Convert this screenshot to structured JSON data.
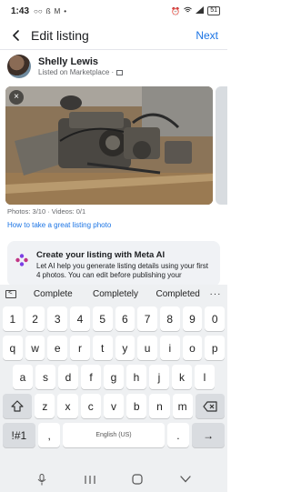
{
  "status_bar": {
    "time": "1:43",
    "left_icons": [
      "voicemail-icon",
      "bluetooth-icon",
      "gmail-icon",
      "dot-icon"
    ],
    "right_icons": [
      "alarm-icon",
      "wifi-icon",
      "signal-icon",
      "battery-icon"
    ],
    "battery_text": "51"
  },
  "header": {
    "title": "Edit listing",
    "next_label": "Next"
  },
  "profile": {
    "name": "Shelly Lewis",
    "subtitle": "Listed on Marketplace ·"
  },
  "photos": {
    "count_text": "Photos: 3/10 · Videos: 0/1",
    "remove_label": "×",
    "tip_link": "How to take a great listing photo"
  },
  "ai_card": {
    "title": "Create your listing with Meta AI",
    "body": "Let AI help you generate listing details using your first 4 photos. You can edit before publishing your"
  },
  "suggestions": [
    "Complete",
    "Completely",
    "Completed"
  ],
  "suggestions_more": "···",
  "keyboard": {
    "row_numbers": [
      "1",
      "2",
      "3",
      "4",
      "5",
      "6",
      "7",
      "8",
      "9",
      "0"
    ],
    "row_1": [
      "q",
      "w",
      "e",
      "r",
      "t",
      "y",
      "u",
      "i",
      "o",
      "p"
    ],
    "row_2": [
      "a",
      "s",
      "d",
      "f",
      "g",
      "h",
      "j",
      "k",
      "l"
    ],
    "row_3": [
      "z",
      "x",
      "c",
      "v",
      "b",
      "n",
      "m"
    ],
    "symbols_label": "!#1",
    "comma_label": ",",
    "space_label": "English (US)",
    "period_label": ".",
    "done_label": "→"
  },
  "colors": {
    "accent": "#1b74e4",
    "text": "#1c1e21",
    "muted": "#65676b",
    "keyboard_bg": "#eef0f2"
  }
}
